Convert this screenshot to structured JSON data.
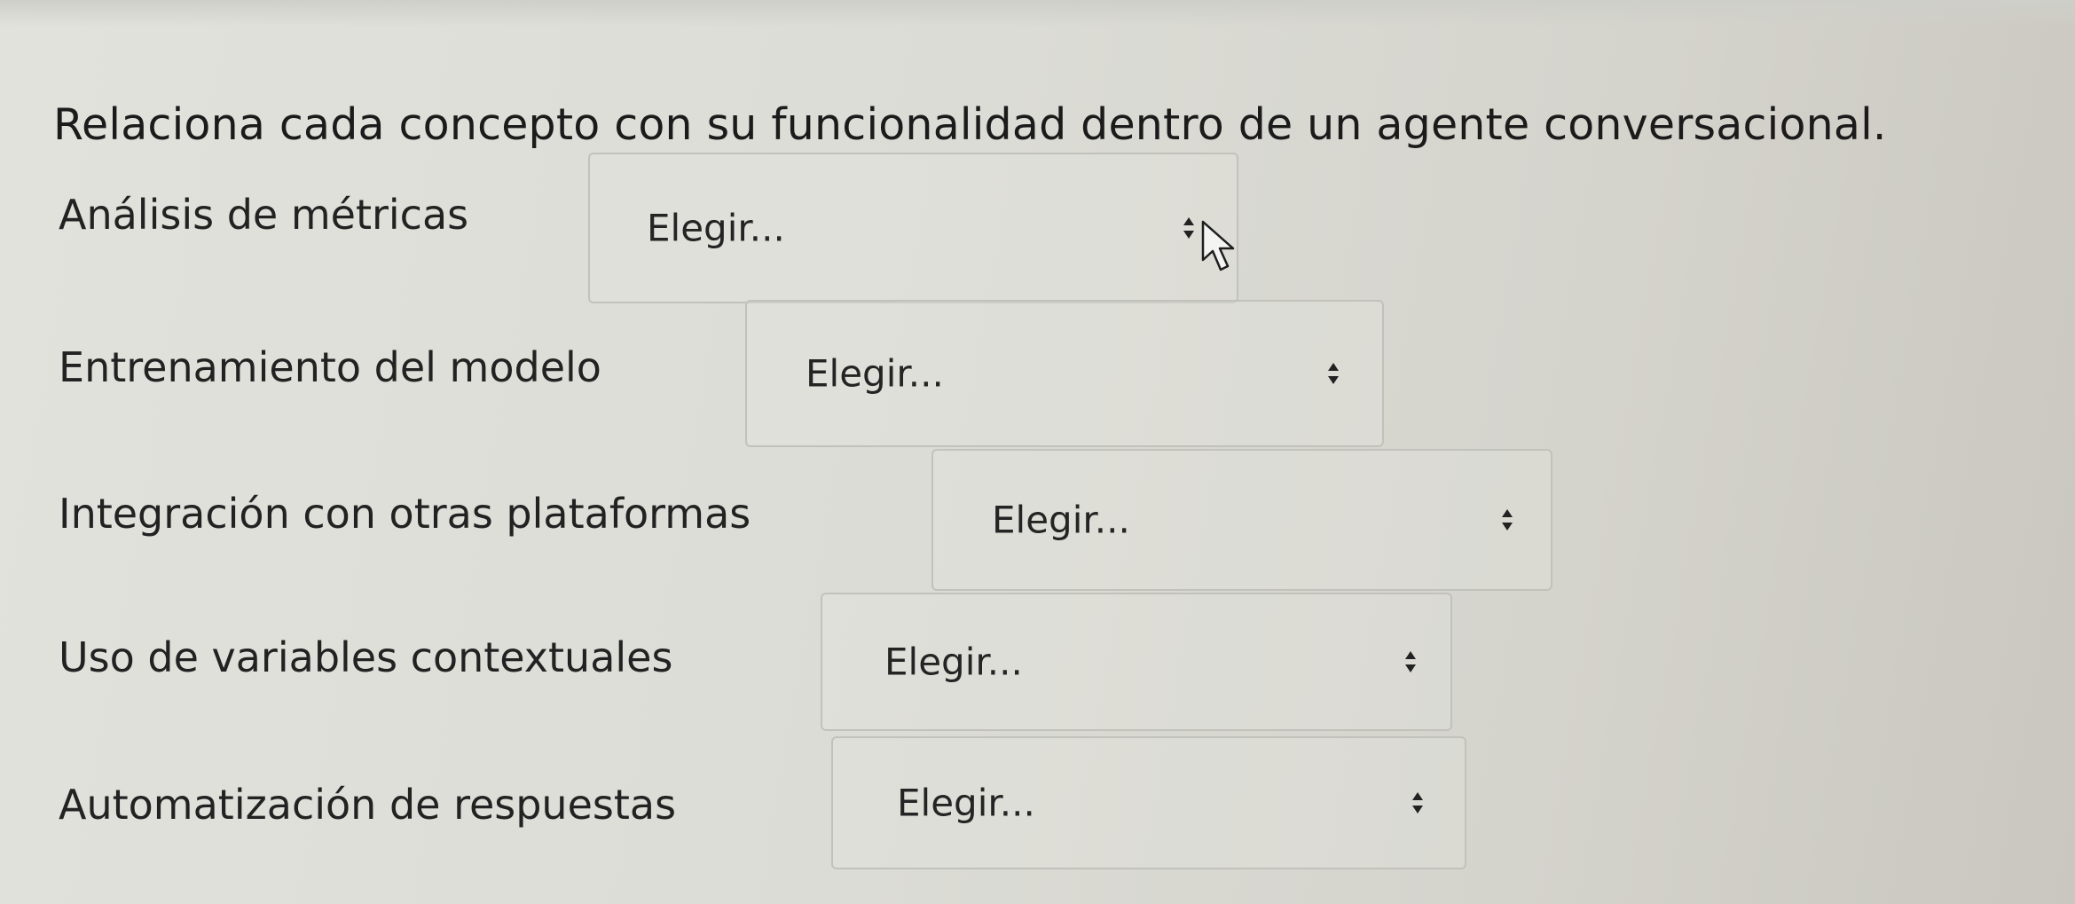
{
  "question": "Relaciona cada concepto con su funcionalidad dentro de un agente conversacional.",
  "rows": [
    {
      "label": "Análisis de métricas",
      "select_value": "Elegir..."
    },
    {
      "label": "Entrenamiento del modelo",
      "select_value": "Elegir..."
    },
    {
      "label": "Integración con otras plataformas",
      "select_value": "Elegir..."
    },
    {
      "label": "Uso de variables contextuales",
      "select_value": "Elegir..."
    },
    {
      "label": "Automatización de respuestas",
      "select_value": "Elegir..."
    }
  ],
  "icons": {
    "select_arrow": "sort-arrows-icon",
    "cursor": "mouse-pointer-icon"
  },
  "colors": {
    "background": "#dcdcd6",
    "text": "#1f1f1f",
    "select_border": "#c2c2bd"
  }
}
